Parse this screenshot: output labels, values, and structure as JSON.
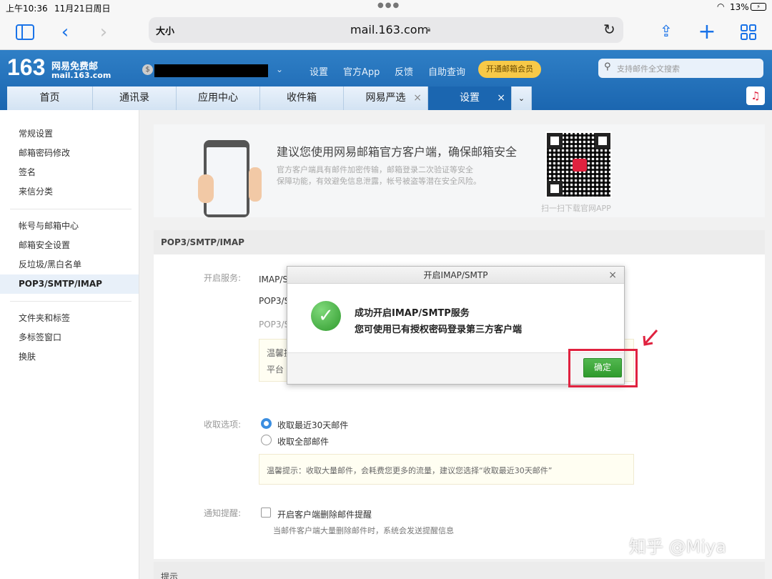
{
  "status_bar": {
    "time": "上午10:36",
    "date": "11月21日周日",
    "battery": "13%"
  },
  "safari": {
    "text_size": "大小",
    "url": "mail.163.com"
  },
  "mail_header": {
    "logo_number": "163",
    "logo_name": "网易免费邮",
    "logo_domain": "mail.163.com",
    "nav_links": [
      "设置",
      "官方App",
      "反馈",
      "自助查询"
    ],
    "vip_button": "开通邮箱会员",
    "search_placeholder": "支持邮件全文搜索"
  },
  "tabs": [
    {
      "label": "首页"
    },
    {
      "label": "通讯录"
    },
    {
      "label": "应用中心"
    },
    {
      "label": "收件箱"
    },
    {
      "label": "网易严选"
    },
    {
      "label": "设置"
    }
  ],
  "sidebar": {
    "group1": [
      "常规设置",
      "邮箱密码修改",
      "签名",
      "来信分类"
    ],
    "group2": [
      "帐号与邮箱中心",
      "邮箱安全设置",
      "反垃圾/黑白名单",
      "POP3/SMTP/IMAP"
    ],
    "group3": [
      "文件夹和标签",
      "多标签窗口",
      "换肤"
    ]
  },
  "promo": {
    "title": "建议您使用网易邮箱官方客户端，确保邮箱安全",
    "desc_line1": "官方客户端具有邮件加密传输，邮箱登录二次验证等安全",
    "desc_line2": "保障功能，有效避免信息泄露，帐号被盗等潜在安全风险。",
    "qr_caption": "扫一扫下载官网APP"
  },
  "section": {
    "title": "POP3/SMTP/IMAP",
    "open_service_label": "开启服务:",
    "services": [
      "IMAP/S",
      "POP3/S",
      "POP3/S"
    ],
    "tip_fragments": [
      "温馨提",
      "平台"
    ],
    "receive_label": "收取选项:",
    "receive_options": [
      "收取最近30天邮件",
      "收取全部邮件"
    ],
    "receive_tip": "温馨提示：收取大量邮件，会耗费您更多的流量，建议您选择“收取最近30天邮件”",
    "notify_label": "通知提醒:",
    "notify_option": "开启客户端删除邮件提醒",
    "notify_desc": "当邮件客户端大量删除邮件时，系统会发送提醒信息",
    "bottom_title": "提示"
  },
  "modal": {
    "title": "开启IMAP/SMTP",
    "message_title": "成功开启IMAP/SMTP服务",
    "message_body": "您可使用已有授权密码登录第三方客户端",
    "ok_label": "确定"
  },
  "watermark": "知乎 @Miya",
  "colors": {
    "header_blue": "#1b66b0",
    "success_green": "#3aa53a",
    "highlight_red": "#e0223f",
    "vip_yellow": "#f7c948"
  }
}
